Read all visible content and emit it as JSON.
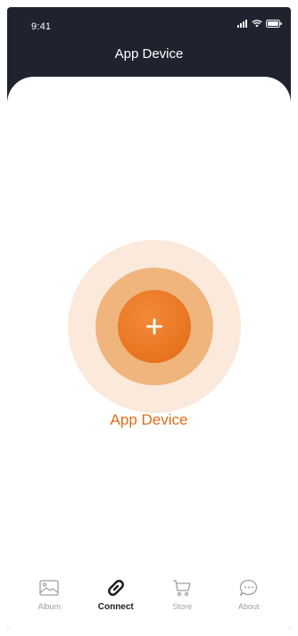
{
  "status_bar": {
    "time": "9:41"
  },
  "header": {
    "title": "App Device"
  },
  "main": {
    "add_label": "App Device",
    "accent": "#e26a12"
  },
  "tabs": [
    {
      "id": "album",
      "label": "Album",
      "icon": "image-icon",
      "active": false
    },
    {
      "id": "connect",
      "label": "Connect",
      "icon": "link-icon",
      "active": true
    },
    {
      "id": "store",
      "label": "Store",
      "icon": "cart-icon",
      "active": false
    },
    {
      "id": "about",
      "label": "About",
      "icon": "chat-bubble-icon",
      "active": false
    }
  ]
}
